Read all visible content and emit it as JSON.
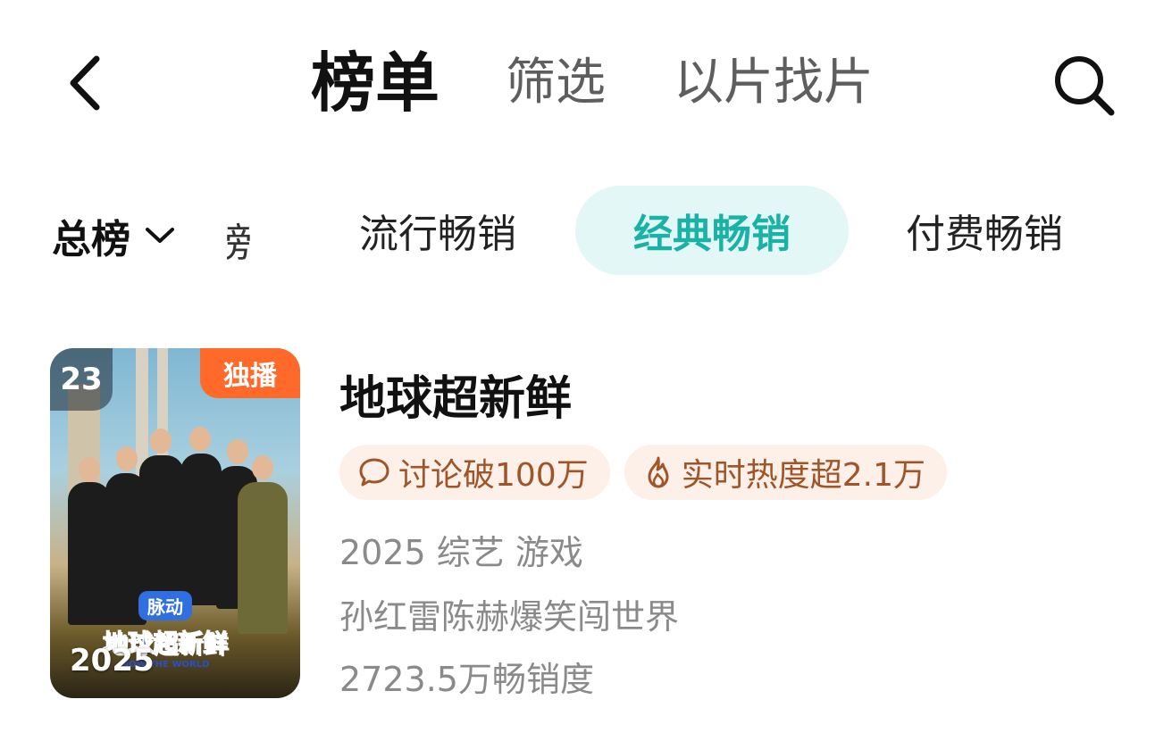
{
  "nav": {
    "back_icon": "chevron-left-icon",
    "tabs": [
      {
        "label": "榜单",
        "active": true
      },
      {
        "label": "筛选",
        "active": false
      },
      {
        "label": "以片找片",
        "active": false
      }
    ],
    "search_icon": "search-icon"
  },
  "categories": {
    "main": {
      "label": "总榜",
      "icon": "chevron-down-icon"
    },
    "partial_label": "榜",
    "chips": [
      {
        "label": "流行畅销",
        "active": false
      },
      {
        "label": "经典畅销",
        "active": true
      },
      {
        "label": "付费畅销",
        "active": false
      }
    ],
    "accent_color": "#18b3a6"
  },
  "item": {
    "rank": "23",
    "badge": "独播",
    "poster": {
      "brand": "脉动",
      "logo_title": "地球超新鲜",
      "logo_sub": "NOW THE WORLD",
      "year": "2025"
    },
    "title": "地球超新鲜",
    "tags": [
      {
        "icon": "comment-icon",
        "text": "讨论破100万"
      },
      {
        "icon": "flame-icon",
        "text": "实时热度超2.1万"
      }
    ],
    "meta_line": "2025 综艺 游戏",
    "desc": "孙红雷陈赫爆笑闯世界",
    "sales": "2723.5万畅销度"
  }
}
